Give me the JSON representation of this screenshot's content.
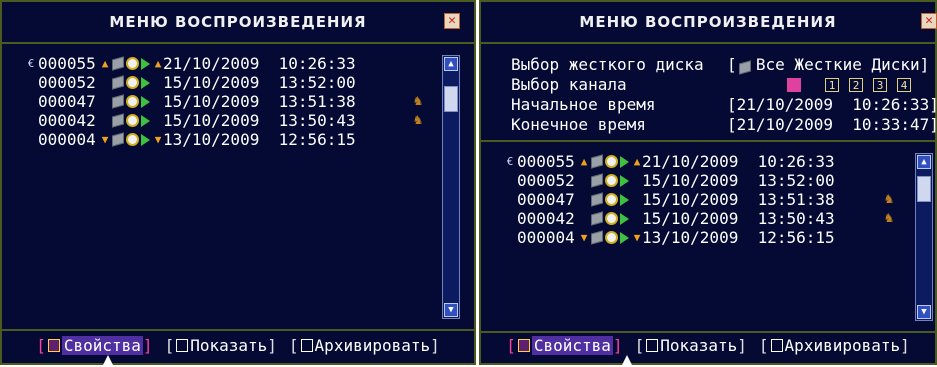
{
  "panels": [
    {
      "title": "МЕНЮ ВОСПРОИЗВЕДЕНИЯ",
      "records": [
        {
          "prefix": "€",
          "id": "000055",
          "mark_before": "▲",
          "mark_after": "▲",
          "datetime": "21/10/2009  10:26:33",
          "person": false
        },
        {
          "prefix": "",
          "id": "000052",
          "mark_before": "",
          "mark_after": "",
          "datetime": "15/10/2009  13:52:00",
          "person": false
        },
        {
          "prefix": "",
          "id": "000047",
          "mark_before": "",
          "mark_after": "",
          "datetime": "15/10/2009  13:51:38",
          "person": true
        },
        {
          "prefix": "",
          "id": "000042",
          "mark_before": "",
          "mark_after": "",
          "datetime": "15/10/2009  13:50:43",
          "person": true
        },
        {
          "prefix": "",
          "id": "000004",
          "mark_before": "▼",
          "mark_after": "▼",
          "datetime": "13/10/2009  12:56:15",
          "person": false
        }
      ],
      "footer": {
        "properties": "Свойства",
        "show": "Показать",
        "archive": "Архивировать"
      }
    },
    {
      "title": "МЕНЮ ВОСПРОИЗВЕДЕНИЯ",
      "filters": {
        "hdd_label": "Выбор жесткого диска",
        "hdd_value": "[  Все Жесткие Диски]",
        "channel_label": "Выбор канала",
        "channels": [
          "",
          "1",
          "2",
          "3",
          "4"
        ],
        "start_label": "Начальное время",
        "start_value": "[21/10/2009  10:26:33]",
        "end_label": "Конечное время",
        "end_value": "[21/10/2009  10:33:47]"
      },
      "records": [
        {
          "prefix": "€",
          "id": "000055",
          "mark_before": "▲",
          "mark_after": "▲",
          "datetime": "21/10/2009  10:26:33",
          "person": false
        },
        {
          "prefix": "",
          "id": "000052",
          "mark_before": "",
          "mark_after": "",
          "datetime": "15/10/2009  13:52:00",
          "person": false
        },
        {
          "prefix": "",
          "id": "000047",
          "mark_before": "",
          "mark_after": "",
          "datetime": "15/10/2009  13:51:38",
          "person": true
        },
        {
          "prefix": "",
          "id": "000042",
          "mark_before": "",
          "mark_after": "",
          "datetime": "15/10/2009  13:50:43",
          "person": true
        },
        {
          "prefix": "",
          "id": "000004",
          "mark_before": "▼",
          "mark_after": "▼",
          "datetime": "13/10/2009  12:56:15",
          "person": false
        }
      ],
      "footer": {
        "properties": "Свойства",
        "show": "Показать",
        "archive": "Архивировать"
      }
    }
  ],
  "icons": {
    "close": "close-icon",
    "hdd": "hdd-icon",
    "clock": "clock-icon",
    "play": "play-icon",
    "person": "person-icon",
    "scroll_up": "scroll-up-icon",
    "scroll_down": "scroll-down-icon"
  },
  "colors": {
    "background": "#040a33",
    "border": "#4a5a20",
    "selected_bracket": "#ff40a0",
    "selected_fill": "#5030a0",
    "play": "#40c040",
    "marker": "#f0a020"
  }
}
